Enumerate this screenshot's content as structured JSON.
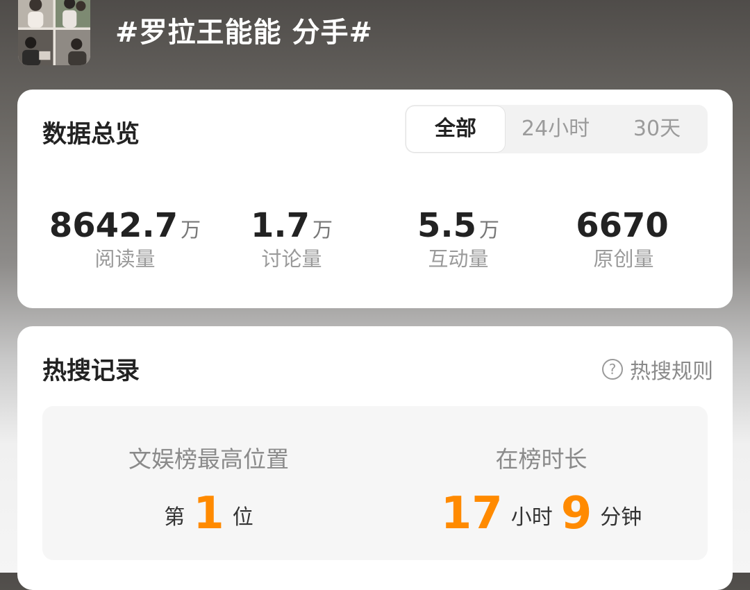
{
  "header": {
    "title": "#罗拉王能能 分手#"
  },
  "overview": {
    "title": "数据总览",
    "tabs": [
      "全部",
      "24小时",
      "30天"
    ],
    "active_tab": "全部",
    "stats": [
      {
        "value": "8642.7",
        "unit": "万",
        "label": "阅读量"
      },
      {
        "value": "1.7",
        "unit": "万",
        "label": "讨论量"
      },
      {
        "value": "5.5",
        "unit": "万",
        "label": "互动量"
      },
      {
        "value": "6670",
        "unit": "",
        "label": "原创量"
      }
    ]
  },
  "hot": {
    "title": "热搜记录",
    "rules_label": "热搜规则",
    "rank": {
      "label": "文娱榜最高位置",
      "prefix": "第",
      "value": "1",
      "suffix": "位"
    },
    "duration": {
      "label": "在榜时长",
      "hours": "17",
      "hours_unit": "小时",
      "minutes": "9",
      "minutes_unit": "分钟"
    }
  },
  "colors": {
    "accent": "#ff8a00",
    "text": "#222222",
    "muted": "#9a9a9a"
  },
  "icons": {
    "help": "question-circle-icon"
  }
}
